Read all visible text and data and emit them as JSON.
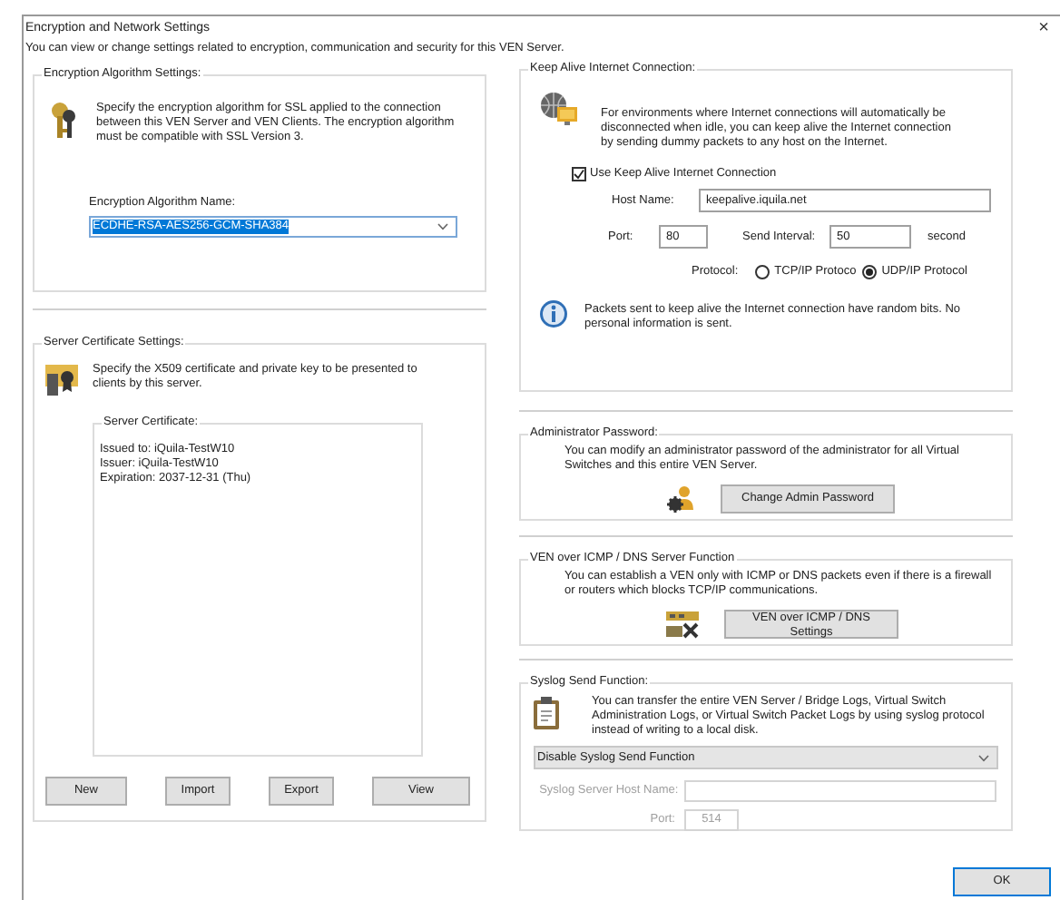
{
  "window": {
    "title": "Encryption and Network Settings",
    "close": "×"
  },
  "description": "You can view or change settings related to encryption, communication and security for this VEN Server.",
  "encryption": {
    "legend": "Encryption Algorithm Settings:",
    "description": "Specify the encryption algorithm for SSL applied to the connection between this VEN Server and VEN Clients. The encryption algorithm must be compatible with SSL Version 3.",
    "name_label": "Encryption Algorithm Name:",
    "algorithm": {
      "value": "ECDHE-RSA-AES256-GCM-SHA384",
      "highlighted": true
    }
  },
  "server_certificate": {
    "legend": "Server Certificate Settings:",
    "description": "Specify the X509 certificate and private key to be presented to clients by this server.",
    "certificate": {
      "legend": "Server Certificate:",
      "lines": [
        "Issued to: iQuila-TestW10",
        "Issuer: iQuila-TestW10",
        "Expiration: 2037-12-31 (Thu)"
      ]
    },
    "buttons": [
      {
        "label": "New"
      },
      {
        "label": "Import"
      },
      {
        "label": "Export"
      },
      {
        "label": "View"
      }
    ]
  },
  "keep_alive": {
    "legend": "Keep Alive Internet Connection:",
    "description": "For environments where Internet connections will automatically be disconnected when idle, you can keep alive the Internet connection by sending dummy packets to any host on the Internet.",
    "use_keep_alive": {
      "label": "Use Keep Alive Internet Connection",
      "checked": true
    },
    "host_name": {
      "label": "Host Name:",
      "value": "keepalive.iquila.net"
    },
    "port": {
      "label": "Port:",
      "value": "80"
    },
    "send_interval": {
      "label": "Send Interval:",
      "value": "50",
      "unit": "second"
    },
    "protocol": {
      "label": "Protocol:",
      "options": [
        {
          "label": "TCP/IP Protoco",
          "selected": false
        },
        {
          "label": "UDP/IP Protocol",
          "selected": true
        }
      ]
    },
    "note": "Packets sent to keep alive the Internet connection have random bits. No personal information is sent."
  },
  "admin_password": {
    "legend": "Administrator Password:",
    "description": "You can modify an administrator password of the administrator for all Virtual Switches and this entire VEN Server.",
    "button": "Change Admin Password"
  },
  "icmp_dns": {
    "legend": "VEN over ICMP / DNS Server Function",
    "description": "You can establish a VEN only with ICMP or DNS packets even if there is a firewall or routers which blocks TCP/IP communications.",
    "button": "VEN over ICMP / DNS Settings"
  },
  "syslog": {
    "legend": "Syslog Send Function:",
    "description": "You can transfer the entire VEN Server / Bridge Logs, Virtual Switch Administration Logs, or Virtual Switch Packet Logs by using syslog protocol instead of writing to a local disk.",
    "mode": {
      "value": "Disable Syslog Send Function"
    },
    "host_name": {
      "label": "Syslog Server Host Name:",
      "disabled": true
    },
    "port": {
      "label": "Port:",
      "value": "514",
      "disabled": true
    }
  },
  "ok_button": "OK"
}
